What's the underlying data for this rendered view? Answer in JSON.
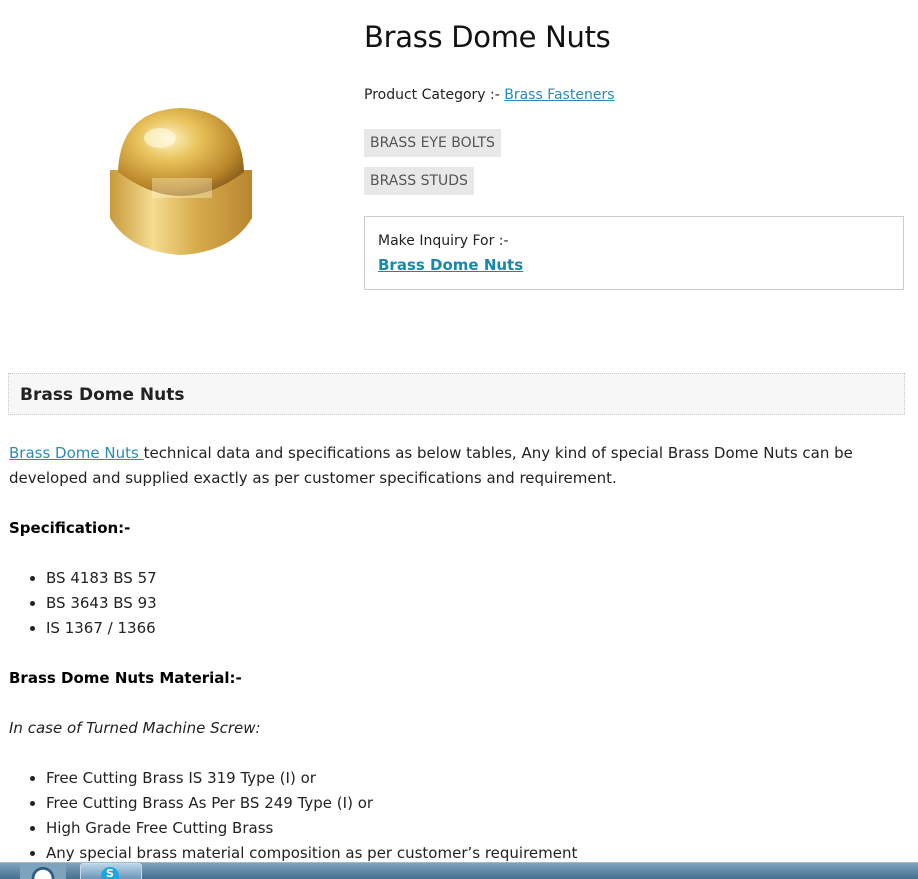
{
  "product": {
    "title": "Brass Dome Nuts",
    "category_label": "Product Category :- ",
    "category_link": "Brass Fasteners"
  },
  "tags": [
    "BRASS EYE BOLTS",
    "BRASS STUDS"
  ],
  "inquiry": {
    "label": "Make Inquiry For :-",
    "link": "Brass Dome Nuts"
  },
  "section": {
    "heading": "Brass Dome Nuts"
  },
  "intro": {
    "link": "Brass Dome Nuts ",
    "text": "technical data and specifications as below tables, Any kind of special Brass Dome Nuts can be developed and supplied exactly as per customer specifications and requirement."
  },
  "specification": {
    "heading": "Specification:-",
    "items": [
      "BS 4183 BS 57",
      "BS 3643 BS 93",
      "IS 1367 / 1366"
    ]
  },
  "material": {
    "heading": "Brass Dome Nuts Material:-",
    "subheading": "In case of Turned Machine Screw:",
    "items": [
      "Free Cutting Brass IS 319 Type (I) or",
      "Free Cutting Brass As Per BS 249 Type (I) or",
      "High Grade Free Cutting Brass",
      "Any special brass material composition as per customer’s requirement"
    ]
  },
  "colors": {
    "link": "#2a8bb5",
    "brass": "#d9a93a"
  },
  "icons": {
    "product_image": "brass-dome-nut-image",
    "taskbar_start": "windows-start-icon",
    "taskbar_app": "skype-icon"
  }
}
